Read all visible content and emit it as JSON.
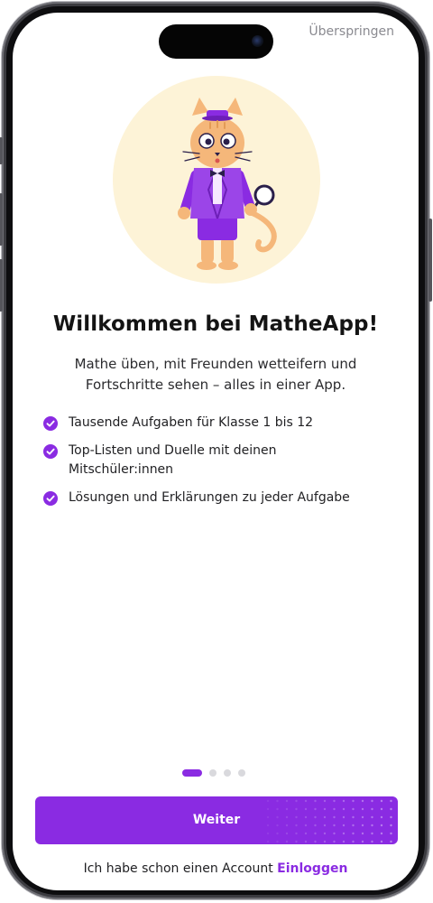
{
  "header": {
    "skip_label": "Überspringen"
  },
  "hero": {
    "illustration_icon": "cat-detective-illustration",
    "circle_color": "#fdf3d7"
  },
  "onboarding": {
    "title": "Willkommen bei MatheApp!",
    "subtitle": "Mathe üben, mit Freunden wetteifern und Fortschritte sehen – alles in einer App.",
    "features": [
      {
        "icon": "check-circle-icon",
        "text": "Tausende Aufgaben für Klasse 1 bis 12"
      },
      {
        "icon": "check-circle-icon",
        "text": "Top-Listen und Duelle mit deinen Mitschüler:innen"
      },
      {
        "icon": "check-circle-icon",
        "text": "Lösungen und Erklärungen zu jeder Aufgabe"
      }
    ]
  },
  "pagination": {
    "current_page": 1,
    "total_pages": 4
  },
  "actions": {
    "continue_label": "Weiter",
    "account_prompt": "Ich habe schon einen Account",
    "login_label": "Einloggen"
  },
  "colors": {
    "accent": "#8a2be2",
    "text_primary": "#141414",
    "text_muted": "#8a8a90",
    "dot_inactive": "#d9d9dd"
  }
}
